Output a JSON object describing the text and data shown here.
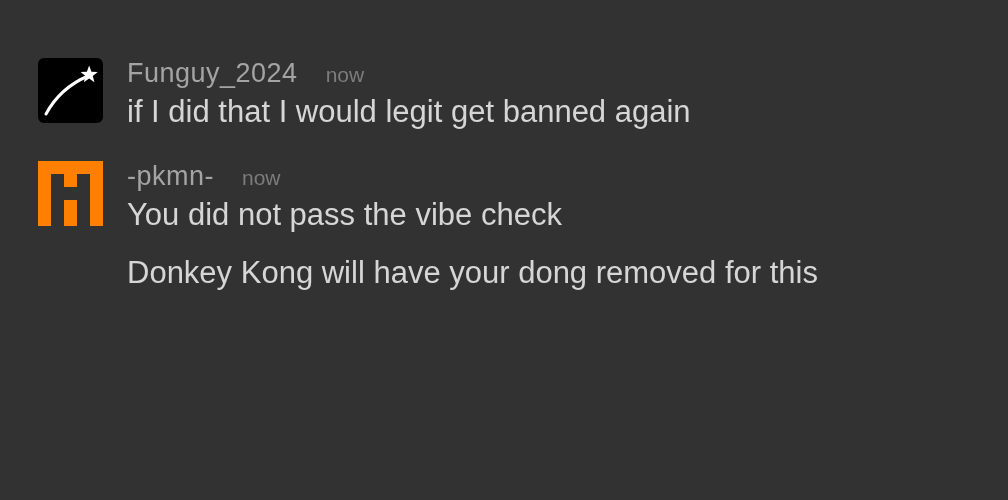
{
  "messages": [
    {
      "kind": "star",
      "username": "Funguy_2024",
      "time": "now",
      "paragraphs": [
        "if I did that I would legit get banned again"
      ]
    },
    {
      "kind": "pixel",
      "username": "-pkmn-",
      "time": "now",
      "paragraphs": [
        "You did not pass the vibe check",
        "Donkey Kong will have your dong removed for this"
      ]
    }
  ]
}
